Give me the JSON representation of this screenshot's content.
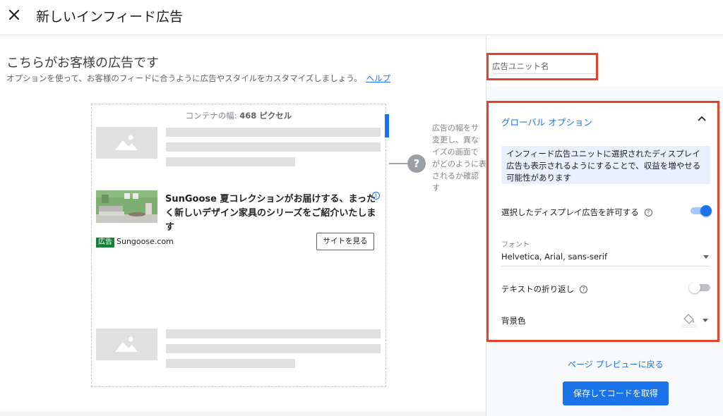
{
  "header": {
    "close_icon": "close-icon",
    "title": "新しいインフィード広告"
  },
  "preview": {
    "heading": "こちらがお客様の広告です",
    "description": "オプションを使って、お客様のフィードに合うように広告やスタイルをカスタマイズしましょう。",
    "help_link": "ヘルプ",
    "container_width_label": "コンテナの幅: ",
    "container_width_value": "468 ピクセル",
    "ad": {
      "title": "SunGoose 夏コレクションがお届けする、まったく新しいデザイン家具のシリーズをご紹介いたします",
      "badge": "広告",
      "domain": "Sungoose.com",
      "cta": "サイトを見る",
      "info_icon": "i"
    },
    "help_icon": "?",
    "help_lines": [
      "広告の幅をサ",
      "変更し、異な",
      "イズの画面で",
      "がどのように表",
      "されるか確認",
      "す"
    ]
  },
  "panel": {
    "unit_name_placeholder": "広告ユニット名",
    "global_options": {
      "title": "グローバル オプション",
      "info": "インフィード広告ユニットに選択されたディスプレイ広告も表示されるようにすることで、収益を増やせる可能性があります",
      "allow_display_label": "選択したディスプレイ広告を許可する",
      "allow_display_on": true,
      "font_caption": "フォント",
      "font_value": "Helvetica, Arial, sans-serif",
      "text_wrap_label": "テキストの折り返し",
      "text_wrap_on": false,
      "bg_color_label": "背景色",
      "help_icon": "?"
    },
    "back_link": "ページ プレビューに戻る",
    "save_button": "保存してコードを取得"
  },
  "colors": {
    "accent": "#1a73e8",
    "highlight_box": "#e8412b",
    "ad_badge": "#188038"
  }
}
